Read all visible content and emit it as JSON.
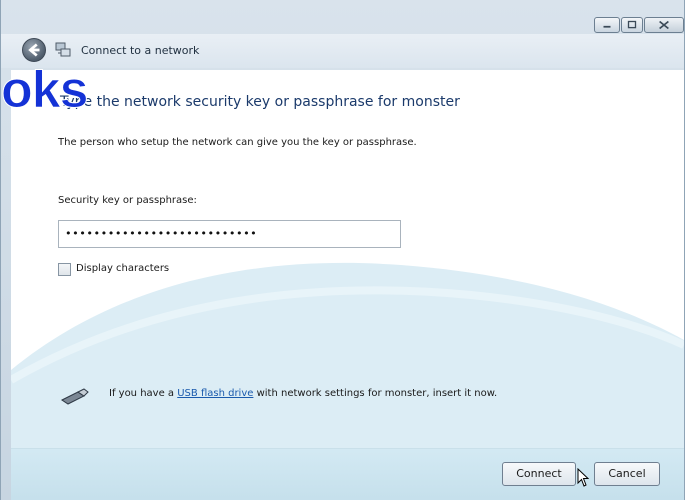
{
  "window": {
    "controls": {
      "minimize": "minimize",
      "maximize": "maximize",
      "close": "close"
    }
  },
  "nav": {
    "title": "Connect to a network",
    "icons": {
      "back": "back-arrow-icon",
      "network": "network-icon"
    }
  },
  "main": {
    "heading": "Type the network security key or passphrase for monster",
    "description": "The person who setup the network can give you the key or passphrase.",
    "key_label": "Security key or passphrase:",
    "key_value": "•••••••••••••••••••••••••••",
    "display_characters_label": "Display characters",
    "display_characters_checked": false,
    "usb": {
      "prefix": "If you have a ",
      "link": "USB flash drive",
      "suffix": " with network settings for monster, insert it now."
    }
  },
  "footer": {
    "connect_label": "Connect",
    "cancel_label": "Cancel"
  },
  "overlay_text": "oks",
  "colors": {
    "heading": "#1b3a6b",
    "link": "#1a5aad",
    "overlay": "#1432d6",
    "wave": "#dcedf5"
  }
}
